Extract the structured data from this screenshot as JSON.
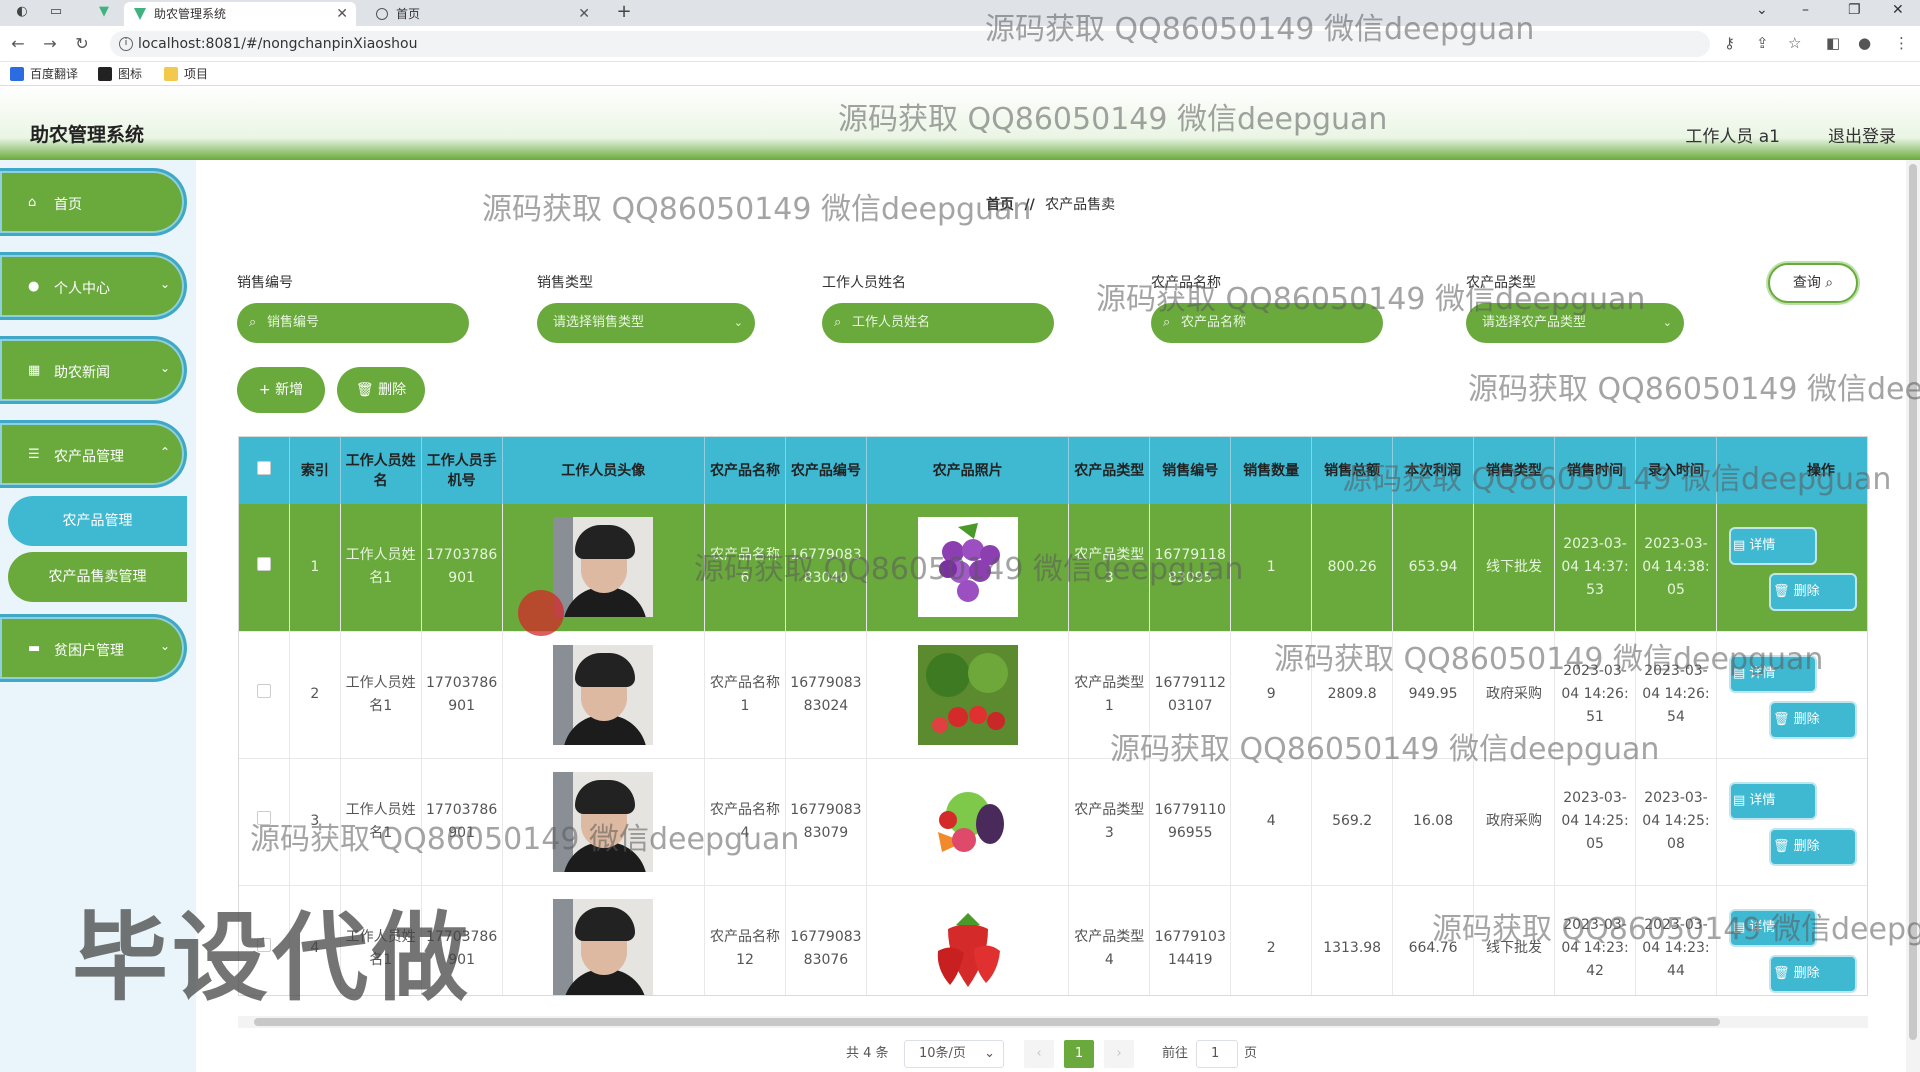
{
  "browser": {
    "tabs": [
      {
        "title": "助农管理系统",
        "active": true
      },
      {
        "title": "首页",
        "active": false
      }
    ],
    "url": "localhost:8081/#/nongchanpinXiaoshou",
    "bookmarks": [
      "百度翻译",
      "图标",
      "项目"
    ]
  },
  "header": {
    "title": "助农管理系统",
    "user": "工作人员 a1",
    "logout": "退出登录"
  },
  "sidebar": {
    "items": [
      {
        "label": "首页",
        "icon": "home-icon"
      },
      {
        "label": "个人中心",
        "icon": "user-icon"
      },
      {
        "label": "助农新闻",
        "icon": "grid-icon"
      },
      {
        "label": "农产品管理",
        "icon": "list-icon"
      },
      {
        "label": "农产品管理",
        "sub": true
      },
      {
        "label": "农产品售卖管理",
        "sub": true
      },
      {
        "label": "贫困户管理",
        "icon": "monitor-icon"
      }
    ]
  },
  "breadcrumb": {
    "home": "首页",
    "sep": "//",
    "current": "农产品售卖"
  },
  "filters": {
    "fields": [
      {
        "label": "销售编号",
        "placeholder": "销售编号"
      },
      {
        "label": "销售类型",
        "placeholder": "请选择销售类型"
      },
      {
        "label": "工作人员姓名",
        "placeholder": "工作人员姓名"
      },
      {
        "label": "农产品名称",
        "placeholder": "农产品名称"
      },
      {
        "label": "农产品类型",
        "placeholder": "请选择农产品类型"
      }
    ],
    "query": "查询"
  },
  "actions": {
    "add": "新增",
    "delete": "删除"
  },
  "table": {
    "columns": [
      "索引",
      "工作人员姓名",
      "工作人员手机号",
      "工作人员头像",
      "农产品名称",
      "农产品编号",
      "农产品照片",
      "农产品类型",
      "销售编号",
      "销售数量",
      "销售总额",
      "本次利润",
      "销售类型",
      "销售时间",
      "录入时间",
      "操作"
    ],
    "rows": [
      {
        "idx": "1",
        "name": "工作人员姓名1",
        "phone": "17703786901",
        "product": "农产品名称6",
        "code": "1677908383040",
        "type": "农产品类型3",
        "sale_no": "1677911883095",
        "qty": "1",
        "total": "800.26",
        "profit": "653.94",
        "sale_type": "线下批发",
        "sale_time": "2023-03-04 14:37:53",
        "entry_time": "2023-03-04 14:38:05",
        "photo": "grapes"
      },
      {
        "idx": "2",
        "name": "工作人员姓名1",
        "phone": "17703786901",
        "product": "农产品名称1",
        "code": "1677908383024",
        "type": "农产品类型1",
        "sale_no": "1677911203107",
        "qty": "9",
        "total": "2809.8",
        "profit": "949.95",
        "sale_type": "政府采购",
        "sale_time": "2023-03-04 14:26:51",
        "entry_time": "2023-03-04 14:26:54",
        "photo": "vegetables"
      },
      {
        "idx": "3",
        "name": "工作人员姓名1",
        "phone": "17703786901",
        "product": "农产品名称4",
        "code": "1677908383079",
        "type": "农产品类型3",
        "sale_no": "1677911096955",
        "qty": "4",
        "total": "569.2",
        "profit": "16.08",
        "sale_type": "政府采购",
        "sale_time": "2023-03-04 14:25:05",
        "entry_time": "2023-03-04 14:25:08",
        "photo": "veg-mix"
      },
      {
        "idx": "4",
        "name": "工作人员姓名1",
        "phone": "17703786901",
        "product": "农产品名称12",
        "code": "1677908383076",
        "type": "农产品类型4",
        "sale_no": "1677910314419",
        "qty": "2",
        "total": "1313.98",
        "profit": "664.76",
        "sale_type": "线下批发",
        "sale_time": "2023-03-04 14:23:42",
        "entry_time": "2023-03-04 14:23:44",
        "photo": "strawberry"
      }
    ],
    "op_detail": "详情",
    "op_delete": "删除"
  },
  "pagination": {
    "total": "共 4 条",
    "page_size": "10条/页",
    "current": "1",
    "goto_prefix": "前往",
    "goto_value": "1",
    "goto_suffix": "页"
  },
  "watermark": {
    "text": "源码获取 QQ86050149 微信deepguan",
    "big": "毕设代做"
  },
  "colors": {
    "green": "#6aaa3d",
    "blue": "#3fb8d1"
  }
}
